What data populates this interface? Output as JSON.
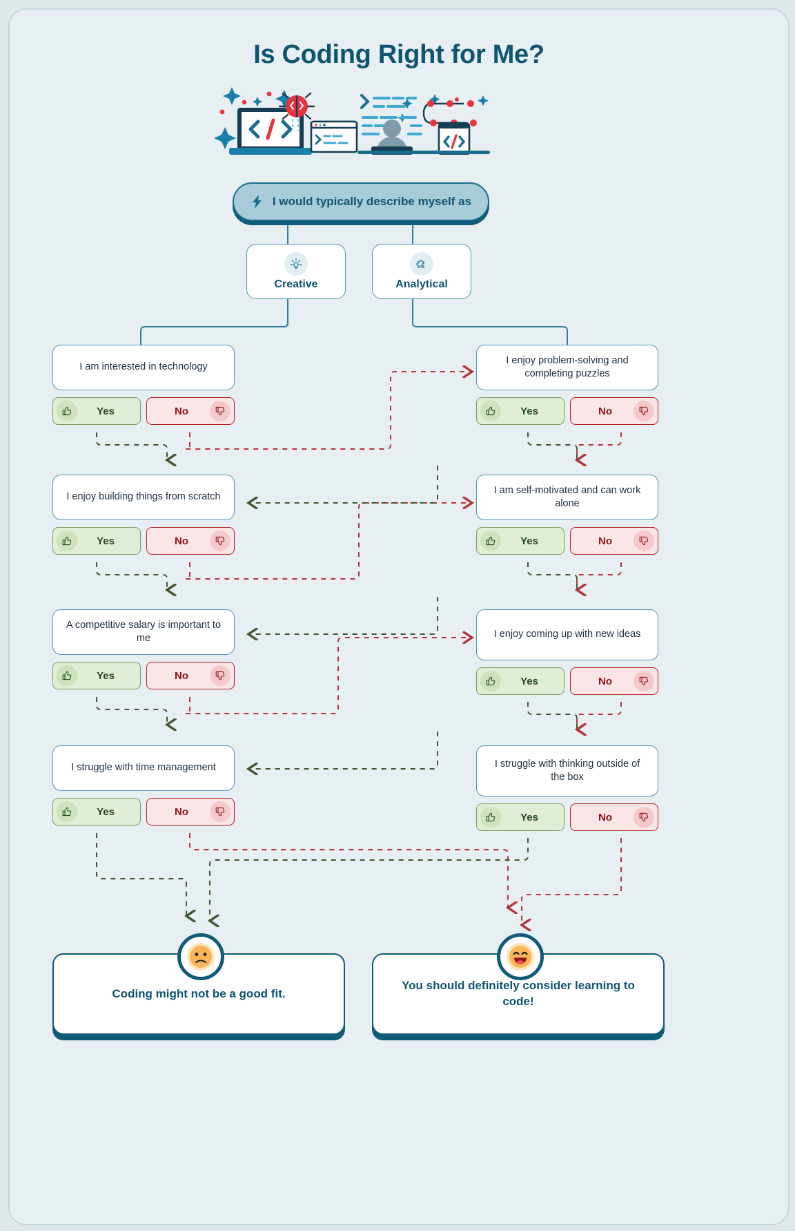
{
  "header": {
    "title": "Is Coding Right for Me?",
    "hero_icon": "coding-illustration"
  },
  "root_question": {
    "icon": "lightning-bolt-icon",
    "label": "I would typically describe myself as"
  },
  "options": [
    {
      "id": "creative",
      "label": "Creative",
      "icon": "lightbulb-icon"
    },
    {
      "id": "analytical",
      "label": "Analytical",
      "icon": "puzzle-piece-icon"
    }
  ],
  "answer_labels": {
    "yes": "Yes",
    "no": "No",
    "yes_icon": "thumbs-up-icon",
    "no_icon": "thumbs-down-icon"
  },
  "questions": [
    {
      "id": "q-tech",
      "column": "left",
      "text": "I am interested in technology"
    },
    {
      "id": "q-problem",
      "column": "right",
      "text": "I enjoy problem-solving and completing puzzles"
    },
    {
      "id": "q-build",
      "column": "left",
      "text": "I enjoy building things from scratch"
    },
    {
      "id": "q-selfmot",
      "column": "right",
      "text": "I am self-motivated and can work alone"
    },
    {
      "id": "q-salary",
      "column": "left",
      "text": "A competitive salary is important to me"
    },
    {
      "id": "q-ideas",
      "column": "right",
      "text": "I enjoy coming up with new ideas"
    },
    {
      "id": "q-time",
      "column": "left",
      "text": "I struggle with time management"
    },
    {
      "id": "q-outsidebox",
      "column": "right",
      "text": "I struggle with thinking outside of the box"
    }
  ],
  "results": [
    {
      "id": "result-negative",
      "text": "Coding might not be a good fit.",
      "face": "frowning-face-icon"
    },
    {
      "id": "result-positive",
      "text": "You should definitely consider learning to code!",
      "face": "grinning-face-icon"
    }
  ],
  "colors": {
    "page_background": "#e7eff2",
    "brand_dark_teal": "#0f5471",
    "brand_mid_blue": "#4e96b1",
    "pill_fill": "#a9ccd9",
    "yes_fill": "#dfeed4",
    "yes_border": "#7d9a63",
    "yes_text": "#24461c",
    "no_fill": "#fbe6e7",
    "no_border": "#b21f25",
    "no_text": "#8e1418",
    "wire_green": "#3d5730",
    "wire_red": "#b4353b",
    "face_yellow": "#f7b55a",
    "accent_red": "#e8333f"
  }
}
